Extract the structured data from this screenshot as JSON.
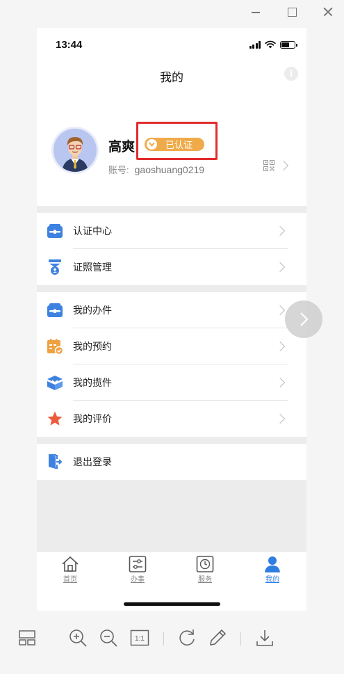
{
  "status_bar": {
    "time": "13:44"
  },
  "nav": {
    "title": "我的",
    "info_glyph": "i"
  },
  "profile": {
    "name": "高爽",
    "cert_badge": "已认证",
    "account_label": "账号:",
    "account_value": "gaoshuang0219"
  },
  "menu_groups": [
    [
      {
        "label": "认证中心",
        "icon": "id-card-icon",
        "color": "#3d82e0"
      },
      {
        "label": "证照管理",
        "icon": "license-stamp-icon",
        "color": "#3d82e0"
      }
    ],
    [
      {
        "label": "我的办件",
        "icon": "briefcase-icon",
        "color": "#3d82e0"
      },
      {
        "label": "我的预约",
        "icon": "calendar-check-icon",
        "color": "#efa142"
      },
      {
        "label": "我的揽件",
        "icon": "package-icon",
        "color": "#3d82e0"
      },
      {
        "label": "我的评价",
        "icon": "star-icon",
        "color": "#ec5b3c"
      }
    ],
    [
      {
        "label": "退出登录",
        "icon": "logout-icon",
        "color": "#3d82e0"
      }
    ]
  ],
  "tabbar": {
    "items": [
      {
        "label": "首页",
        "icon": "home-icon"
      },
      {
        "label": "办事",
        "icon": "sliders-icon"
      },
      {
        "label": "服务",
        "icon": "clock-icon"
      },
      {
        "label": "我的",
        "icon": "user-icon",
        "active": true
      }
    ]
  },
  "colors": {
    "accent": "#2f7de1",
    "badge": "#efab4a",
    "highlight": "#e32b2b"
  },
  "toolbar_icons": [
    "layout-icon",
    "zoom-in-icon",
    "zoom-out-icon",
    "actual-size-icon",
    "rotate-icon",
    "edit-icon",
    "download-icon"
  ],
  "toolbar": {
    "actual_size_label": "1:1"
  }
}
